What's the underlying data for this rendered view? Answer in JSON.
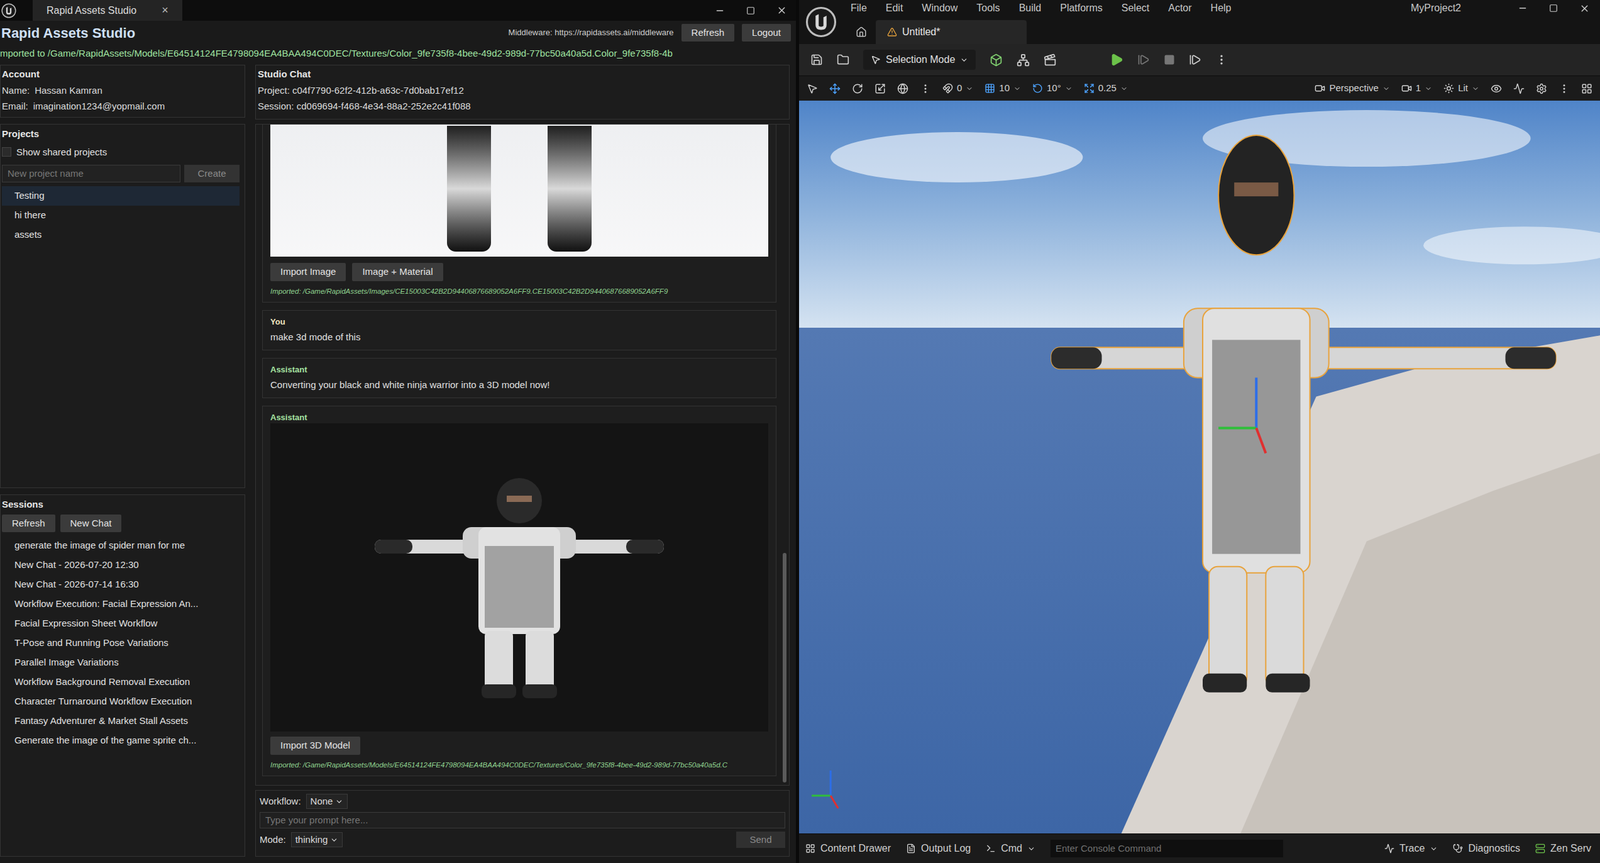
{
  "studio_window": {
    "tab": {
      "title": "Rapid Assets Studio",
      "close": "×"
    },
    "title": "Rapid Assets Studio",
    "middleware": "Middleware: https://rapidassets.ai/middleware",
    "header_buttons": [
      "Refresh",
      "Logout"
    ],
    "import_status": "mported to /Game/RapidAssets/Models/E64514124FE4798094EA4BAA494C0DEC/Textures/Color_9fe735f8-4bee-49d2-989d-77bc50a40a5d.Color_9fe735f8-4b"
  },
  "account": {
    "heading": "Account",
    "name_label": "Name:",
    "name": "Hassan Kamran",
    "email_label": "Email:",
    "email": "imagination1234@yopmail.com"
  },
  "projects": {
    "heading": "Projects",
    "show_shared": {
      "label": "Show shared projects",
      "checked": false
    },
    "new_project_placeholder": "New project name",
    "create_button": "Create",
    "create_disabled": true,
    "items": [
      {
        "label": "Testing",
        "selected": true
      },
      {
        "label": "hi there",
        "selected": false
      },
      {
        "label": "assets",
        "selected": false
      }
    ]
  },
  "sessions": {
    "heading": "Sessions",
    "buttons": [
      "Refresh",
      "New Chat"
    ],
    "items": [
      "generate the image of spider man for me",
      "New Chat - 2026-07-20 12:30",
      "New Chat - 2026-07-14 16:30",
      "Workflow Execution: Facial Expression An...",
      "Facial Expression Sheet Workflow",
      "T-Pose and Running Pose Variations",
      "Parallel Image Variations",
      "Workflow Background Removal Execution",
      "Character Turnaround Workflow Execution",
      "Fantasy Adventurer & Market Stall Assets",
      "Generate the image of the game sprite ch..."
    ]
  },
  "chat": {
    "heading": "Studio Chat",
    "project": "Project: c04f7790-62f2-412b-a63c-7d0bab17ef12",
    "session": "Session: cd069694-f468-4e34-88a2-252e2c41f088",
    "messages": [
      {
        "kind": "image",
        "buttons": [
          "Import Image",
          "Image + Material"
        ],
        "imported": "Imported: /Game/RapidAssets/Images/CE15003C42B2D94406876689052A6FF9.CE15003C42B2D94406876689052A6FF9"
      },
      {
        "kind": "text",
        "author": "You",
        "text": "make 3d mode of this"
      },
      {
        "kind": "text",
        "author": "Assistant",
        "text": "Converting your black and white ninja warrior into a 3D model now!"
      },
      {
        "kind": "model",
        "author": "Assistant",
        "buttons": [
          "Import 3D Model"
        ],
        "imported": "Imported: /Game/RapidAssets/Models/E64514124FE4798094EA4BAA494C0DEC/Textures/Color_9fe735f8-4bee-49d2-989d-77bc50a40a5d.C"
      }
    ],
    "scroll_level": 0.35,
    "workflow_label": "Workflow:",
    "workflow_value": "None",
    "prompt_placeholder": "Type your prompt here...",
    "mode_label": "Mode:",
    "mode_value": "thinking",
    "send": "Send",
    "send_disabled": true
  },
  "unreal": {
    "menu": [
      "File",
      "Edit",
      "Window",
      "Tools",
      "Build",
      "Platforms",
      "Select",
      "Actor",
      "Help"
    ],
    "project": "MyProject2",
    "level_tab": "Untitled*",
    "selection_mode": "Selection Mode",
    "viewport_toolbar": {
      "surface_snap": "0",
      "grid": "10",
      "rotation": "10°",
      "scale": "0.25",
      "view": "Perspective",
      "camera_speed": "1",
      "view_mode": "Lit"
    },
    "status_bar": {
      "content_drawer": "Content Drawer",
      "output_log": "Output Log",
      "cmd": "Cmd",
      "console_placeholder": "Enter Console Command",
      "trace": "Trace",
      "diagnostics": "Diagnostics",
      "zen": "Zen Serv"
    }
  }
}
